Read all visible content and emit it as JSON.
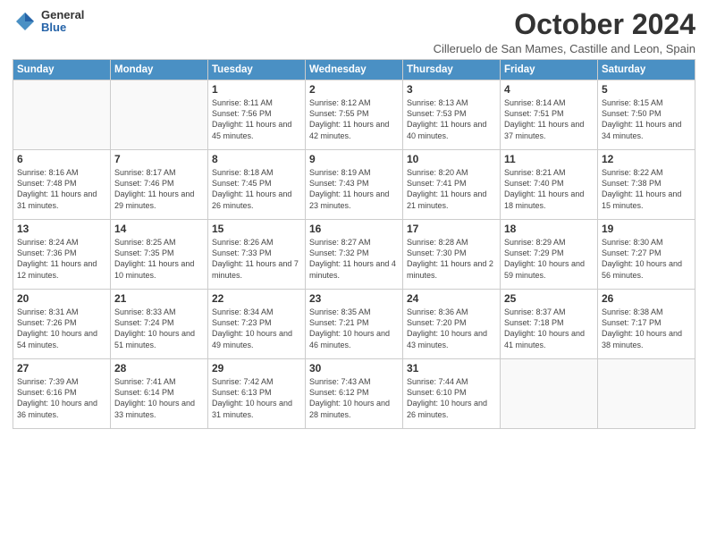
{
  "header": {
    "logo_general": "General",
    "logo_blue": "Blue",
    "month_title": "October 2024",
    "location": "Cilleruelo de San Mames, Castille and Leon, Spain"
  },
  "weekdays": [
    "Sunday",
    "Monday",
    "Tuesday",
    "Wednesday",
    "Thursday",
    "Friday",
    "Saturday"
  ],
  "weeks": [
    [
      {
        "day": "",
        "text": ""
      },
      {
        "day": "",
        "text": ""
      },
      {
        "day": "1",
        "text": "Sunrise: 8:11 AM\nSunset: 7:56 PM\nDaylight: 11 hours and 45 minutes."
      },
      {
        "day": "2",
        "text": "Sunrise: 8:12 AM\nSunset: 7:55 PM\nDaylight: 11 hours and 42 minutes."
      },
      {
        "day": "3",
        "text": "Sunrise: 8:13 AM\nSunset: 7:53 PM\nDaylight: 11 hours and 40 minutes."
      },
      {
        "day": "4",
        "text": "Sunrise: 8:14 AM\nSunset: 7:51 PM\nDaylight: 11 hours and 37 minutes."
      },
      {
        "day": "5",
        "text": "Sunrise: 8:15 AM\nSunset: 7:50 PM\nDaylight: 11 hours and 34 minutes."
      }
    ],
    [
      {
        "day": "6",
        "text": "Sunrise: 8:16 AM\nSunset: 7:48 PM\nDaylight: 11 hours and 31 minutes."
      },
      {
        "day": "7",
        "text": "Sunrise: 8:17 AM\nSunset: 7:46 PM\nDaylight: 11 hours and 29 minutes."
      },
      {
        "day": "8",
        "text": "Sunrise: 8:18 AM\nSunset: 7:45 PM\nDaylight: 11 hours and 26 minutes."
      },
      {
        "day": "9",
        "text": "Sunrise: 8:19 AM\nSunset: 7:43 PM\nDaylight: 11 hours and 23 minutes."
      },
      {
        "day": "10",
        "text": "Sunrise: 8:20 AM\nSunset: 7:41 PM\nDaylight: 11 hours and 21 minutes."
      },
      {
        "day": "11",
        "text": "Sunrise: 8:21 AM\nSunset: 7:40 PM\nDaylight: 11 hours and 18 minutes."
      },
      {
        "day": "12",
        "text": "Sunrise: 8:22 AM\nSunset: 7:38 PM\nDaylight: 11 hours and 15 minutes."
      }
    ],
    [
      {
        "day": "13",
        "text": "Sunrise: 8:24 AM\nSunset: 7:36 PM\nDaylight: 11 hours and 12 minutes."
      },
      {
        "day": "14",
        "text": "Sunrise: 8:25 AM\nSunset: 7:35 PM\nDaylight: 11 hours and 10 minutes."
      },
      {
        "day": "15",
        "text": "Sunrise: 8:26 AM\nSunset: 7:33 PM\nDaylight: 11 hours and 7 minutes."
      },
      {
        "day": "16",
        "text": "Sunrise: 8:27 AM\nSunset: 7:32 PM\nDaylight: 11 hours and 4 minutes."
      },
      {
        "day": "17",
        "text": "Sunrise: 8:28 AM\nSunset: 7:30 PM\nDaylight: 11 hours and 2 minutes."
      },
      {
        "day": "18",
        "text": "Sunrise: 8:29 AM\nSunset: 7:29 PM\nDaylight: 10 hours and 59 minutes."
      },
      {
        "day": "19",
        "text": "Sunrise: 8:30 AM\nSunset: 7:27 PM\nDaylight: 10 hours and 56 minutes."
      }
    ],
    [
      {
        "day": "20",
        "text": "Sunrise: 8:31 AM\nSunset: 7:26 PM\nDaylight: 10 hours and 54 minutes."
      },
      {
        "day": "21",
        "text": "Sunrise: 8:33 AM\nSunset: 7:24 PM\nDaylight: 10 hours and 51 minutes."
      },
      {
        "day": "22",
        "text": "Sunrise: 8:34 AM\nSunset: 7:23 PM\nDaylight: 10 hours and 49 minutes."
      },
      {
        "day": "23",
        "text": "Sunrise: 8:35 AM\nSunset: 7:21 PM\nDaylight: 10 hours and 46 minutes."
      },
      {
        "day": "24",
        "text": "Sunrise: 8:36 AM\nSunset: 7:20 PM\nDaylight: 10 hours and 43 minutes."
      },
      {
        "day": "25",
        "text": "Sunrise: 8:37 AM\nSunset: 7:18 PM\nDaylight: 10 hours and 41 minutes."
      },
      {
        "day": "26",
        "text": "Sunrise: 8:38 AM\nSunset: 7:17 PM\nDaylight: 10 hours and 38 minutes."
      }
    ],
    [
      {
        "day": "27",
        "text": "Sunrise: 7:39 AM\nSunset: 6:16 PM\nDaylight: 10 hours and 36 minutes."
      },
      {
        "day": "28",
        "text": "Sunrise: 7:41 AM\nSunset: 6:14 PM\nDaylight: 10 hours and 33 minutes."
      },
      {
        "day": "29",
        "text": "Sunrise: 7:42 AM\nSunset: 6:13 PM\nDaylight: 10 hours and 31 minutes."
      },
      {
        "day": "30",
        "text": "Sunrise: 7:43 AM\nSunset: 6:12 PM\nDaylight: 10 hours and 28 minutes."
      },
      {
        "day": "31",
        "text": "Sunrise: 7:44 AM\nSunset: 6:10 PM\nDaylight: 10 hours and 26 minutes."
      },
      {
        "day": "",
        "text": ""
      },
      {
        "day": "",
        "text": ""
      }
    ]
  ]
}
